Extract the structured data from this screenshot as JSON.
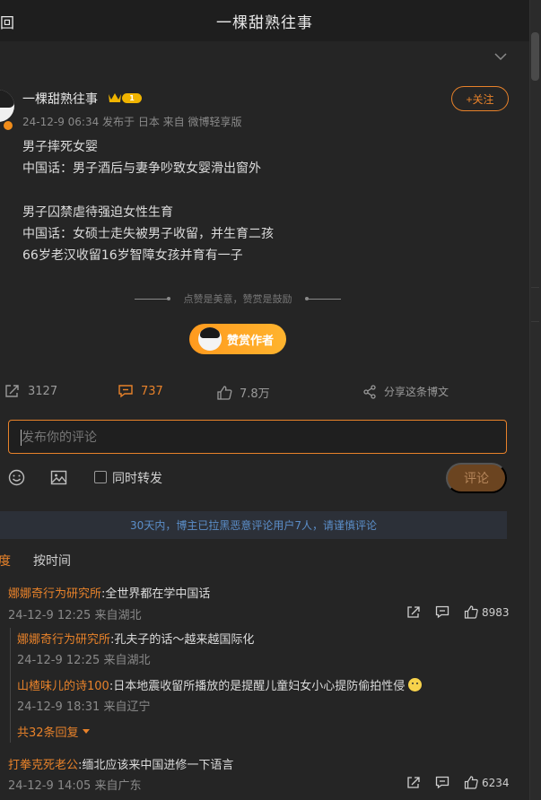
{
  "header": {
    "back": "回",
    "title": "一棵甜熟往事"
  },
  "post": {
    "username": "一棵甜熟往事",
    "level": "1",
    "meta": "24-12-9 06:34  发布于 日本  来自 微博轻享版",
    "follow_label": "+关注",
    "lines": [
      "男子摔死女婴",
      "中国话：男子酒后与妻争吵致女婴滑出窗外",
      "",
      "男子囚禁虐待强迫女性生育",
      "中国话：女硕士走失被男子收留，并生育二孩",
      "66岁老汉收留16岁智障女孩并育有一子"
    ]
  },
  "reward": {
    "hint": "点赞是美意，赞赏是鼓励",
    "button_label": "赞赏作者"
  },
  "actions": {
    "repost": "3127",
    "comment": "737",
    "like": "7.8万",
    "share": "分享这条博文"
  },
  "composer": {
    "placeholder": "发布你的评论",
    "repost_label": "同时转发",
    "submit_label": "评论"
  },
  "notice": "30天内，博主已拉黑恶意评论用户7人，请谨慎评论",
  "sort": {
    "hot": "度",
    "time": "按时间"
  },
  "comments": [
    {
      "name": "娜娜奇行为研究所",
      "text": ":全世界都在学中国话",
      "meta": "24-12-9 12:25  来自湖北",
      "likes": "8983",
      "replies": [
        {
          "name": "娜娜奇行为研究所",
          "text": ":孔夫子的话～越来越国际化",
          "meta": "24-12-9 12:25  来自湖北"
        },
        {
          "name": "山楂味儿的诗100",
          "text": ":日本地震收留所播放的是提醒儿童妇女小心提防偷拍性侵",
          "meta": "24-12-9 18:31  来自辽宁"
        }
      ],
      "more_replies": "共32条回复"
    },
    {
      "name": "打拳克死老公",
      "text": ":缅北应该来中国进修一下语言",
      "meta": "24-12-9 14:05  来自广东",
      "likes": "6234"
    }
  ],
  "colors": {
    "accent": "#e8822a",
    "background": "#1e1e1e",
    "card": "#252525",
    "notice_text": "#5b8ec9"
  }
}
